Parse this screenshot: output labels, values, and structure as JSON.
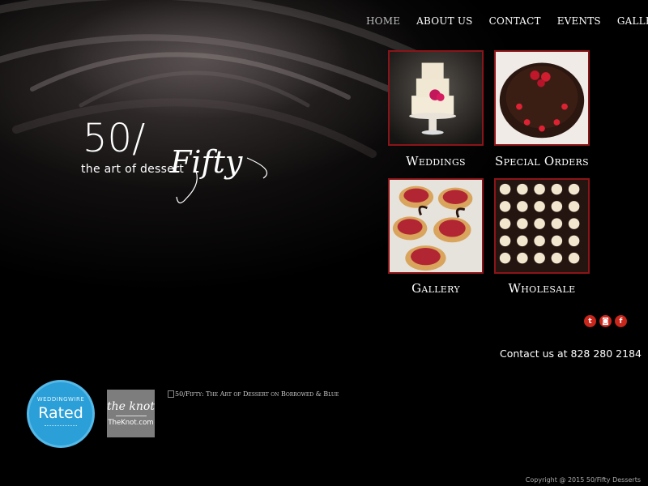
{
  "nav": {
    "items": [
      {
        "label": "HOME",
        "active": true
      },
      {
        "label": "ABOUT US",
        "active": false
      },
      {
        "label": "CONTACT",
        "active": false
      },
      {
        "label": "EVENTS",
        "active": false
      },
      {
        "label": "GALLERY",
        "active": false
      }
    ]
  },
  "logo": {
    "number": "50/",
    "script": "Fifty",
    "tagline": "the art of dessert"
  },
  "tiles": [
    {
      "label": "Weddings",
      "image": "wedding-cake"
    },
    {
      "label": "Special Orders",
      "image": "chocolate-cake"
    },
    {
      "label": "Gallery",
      "image": "strawberry-tarts"
    },
    {
      "label": "Wholesale",
      "image": "chocolate-cups"
    }
  ],
  "social": {
    "icons": [
      "twitter-icon",
      "instagram-icon",
      "facebook-icon"
    ]
  },
  "contact": "Contact us at 828 280 2184",
  "badges": {
    "weddingwire_top": "WEDDINGWIRE",
    "weddingwire_label": "Rated",
    "theknot_logo": "the knot",
    "theknot_url": "TheKnot.com",
    "broken_image_alt": "50/Fifty: The Art of Dessert on Borrowed & Blue"
  },
  "footer": {
    "copyright": "Copyright @ 2015 50/Fifty Desserts"
  },
  "colors": {
    "accent": "#8b1418",
    "social": "#c9261c",
    "weddingwire": "#2a9fd8"
  }
}
